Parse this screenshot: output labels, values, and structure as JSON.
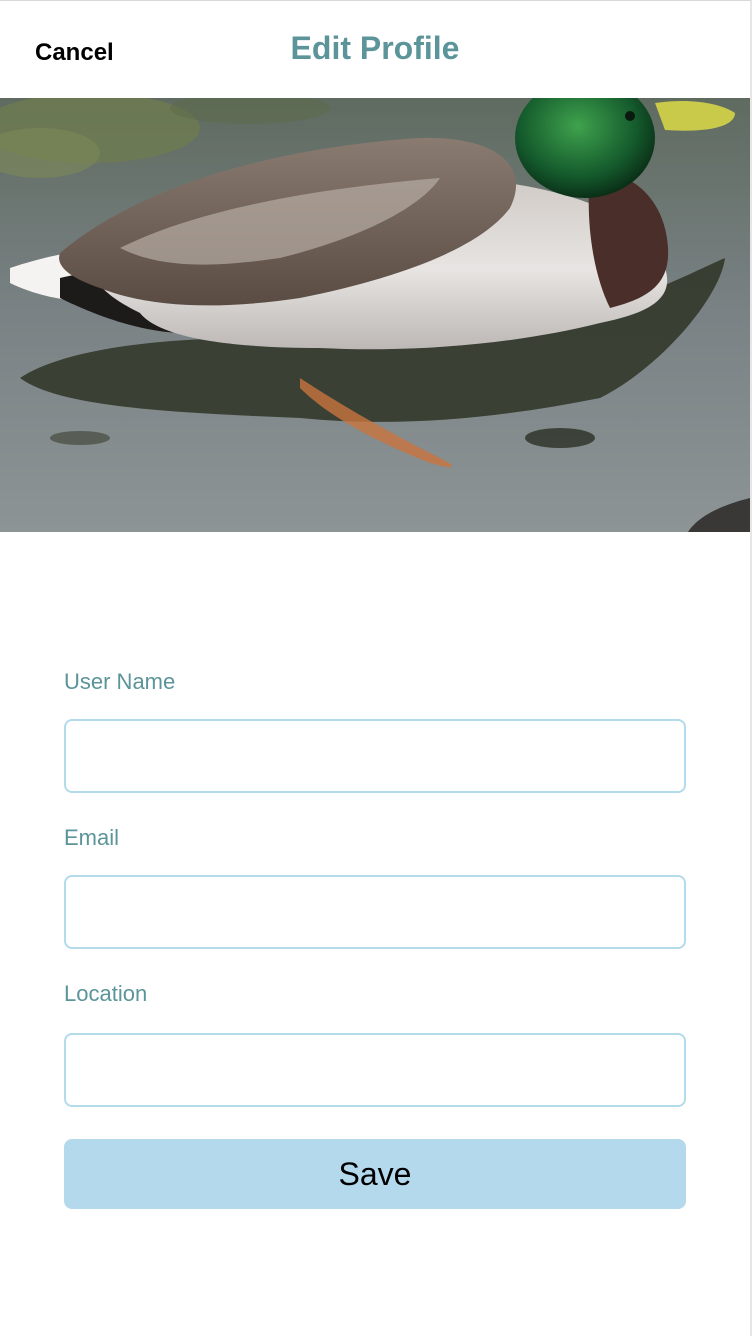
{
  "header": {
    "cancel_label": "Cancel",
    "title": "Edit Profile"
  },
  "cover_photo": {
    "subject": "mallard-duck-photo"
  },
  "form": {
    "fields": [
      {
        "label": "User Name",
        "value": "",
        "placeholder": ""
      },
      {
        "label": "Email",
        "value": "",
        "placeholder": ""
      },
      {
        "label": "Location",
        "value": "",
        "placeholder": ""
      }
    ],
    "save_label": "Save"
  },
  "colors": {
    "accent_teal": "#5b9499",
    "input_border": "#b4dbeb",
    "save_button": "#b4d9ed"
  }
}
